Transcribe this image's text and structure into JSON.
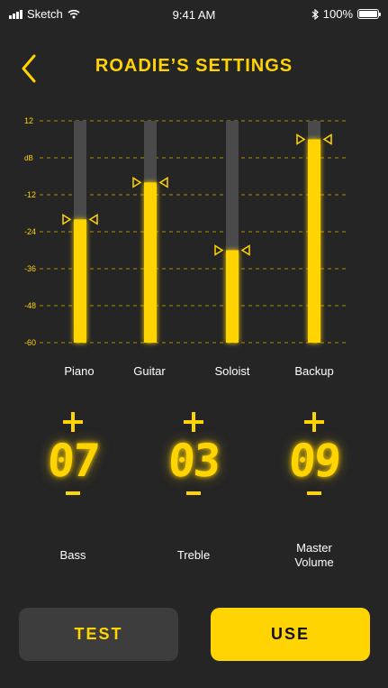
{
  "status_bar": {
    "carrier": "Sketch",
    "time": "9:41 AM",
    "battery": "100%"
  },
  "header": {
    "title": "ROADIE’S SETTINGS",
    "back_icon": "chevron-left-icon"
  },
  "mixer": {
    "db_scale": [
      "12",
      "dB",
      "-12",
      "-24",
      "-36",
      "-48",
      "-60"
    ],
    "channels": [
      {
        "label": "Piano",
        "level_db": -20
      },
      {
        "label": "Guitar",
        "level_db": -8
      },
      {
        "label": "Soloist",
        "level_db": -30
      },
      {
        "label": "Backup",
        "level_db": 6
      }
    ]
  },
  "controls": [
    {
      "value": "07",
      "label": "Bass"
    },
    {
      "value": "03",
      "label": "Treble"
    },
    {
      "value": "09",
      "label": "Master Volume"
    }
  ],
  "buttons": {
    "test": "TEST",
    "use": "USE"
  },
  "colors": {
    "accent": "#ffd400",
    "background": "#252525",
    "track": "#4a4a4a",
    "test_button": "#3d3d3d"
  }
}
